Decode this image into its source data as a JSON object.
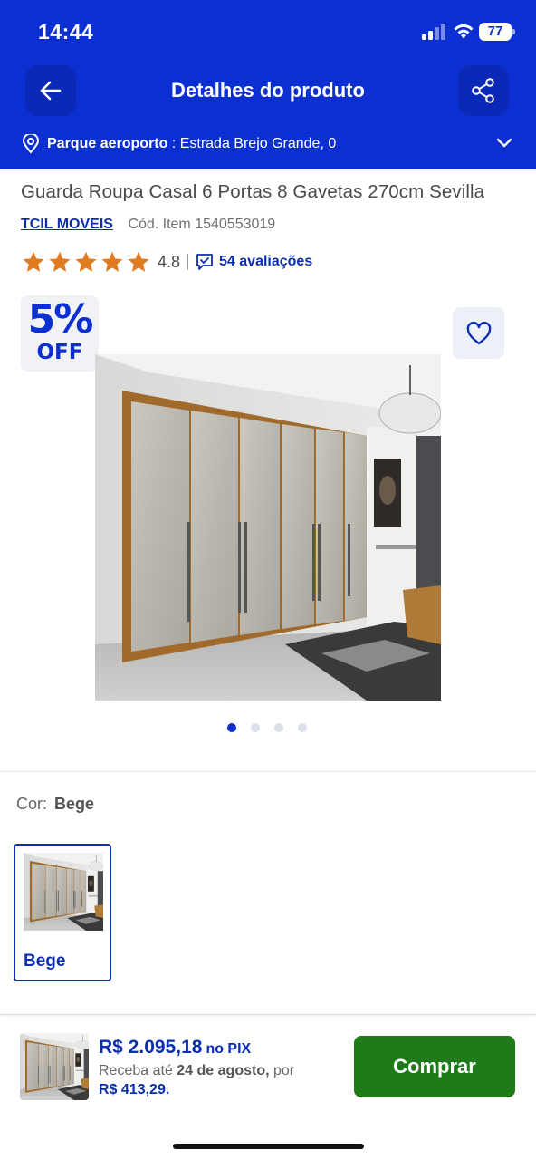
{
  "status_bar": {
    "time": "14:44",
    "battery": "77"
  },
  "nav": {
    "title": "Detalhes do produto",
    "back_icon": "arrow-left-icon",
    "share_icon": "share-icon"
  },
  "location": {
    "name": "Parque aeroporto",
    "separator": " : ",
    "address": "Estrada Brejo Grande, 0"
  },
  "product": {
    "title": "Guarda Roupa Casal 6 Portas 8 Gavetas 270cm Sevilla",
    "brand": "TCIL MOVEIS",
    "item_code": "Cód. Item 1540553019",
    "rating": "4.8",
    "star_count": 5,
    "reviews_label": "54 avaliações",
    "discount_percent": "5%",
    "discount_label": "OFF",
    "gallery_images": 4,
    "gallery_active_index": 0
  },
  "color": {
    "label": "Cor:",
    "selected": "Bege",
    "options": [
      {
        "label": "Bege"
      }
    ]
  },
  "purchase": {
    "price": "R$ 2.095,18",
    "price_suffix": "no PIX",
    "delivery_prefix": "Receba até ",
    "delivery_date": "24 de agosto,",
    "delivery_middle": " por",
    "installment": "R$ 413,29.",
    "buy_label": "Comprar"
  },
  "colors": {
    "header_bg": "#0b2fd0",
    "brand_blue": "#0b2fb0",
    "star": "#e07b1f",
    "buy_button": "#1f7a1a"
  }
}
